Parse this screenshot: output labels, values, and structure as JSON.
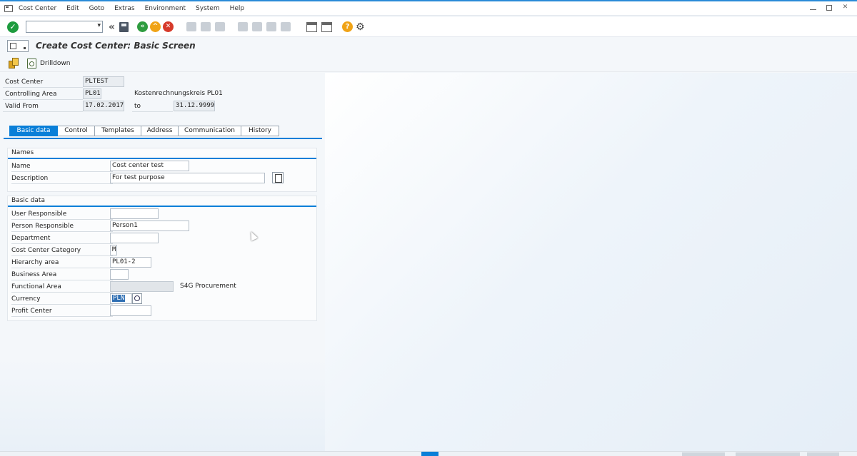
{
  "menubar": {
    "items": [
      "Cost Center",
      "Edit",
      "Goto",
      "Extras",
      "Environment",
      "System",
      "Help"
    ]
  },
  "toolbar": {
    "command_field_value": ""
  },
  "title": "Create Cost Center: Basic Screen",
  "app_toolbar": {
    "drilldown_label": "Drilldown"
  },
  "header_fields": {
    "cost_center_label": "Cost Center",
    "cost_center_value": "PLTEST",
    "controlling_area_label": "Controlling Area",
    "controlling_area_value": "PL01",
    "controlling_area_text": "Kostenrechnungskreis PL01",
    "valid_from_label": "Valid From",
    "valid_from_value": "17.02.2017",
    "to_label": "to",
    "valid_to_value": "31.12.9999"
  },
  "tabs": [
    "Basic data",
    "Control",
    "Templates",
    "Address",
    "Communication",
    "History"
  ],
  "names_group": {
    "title": "Names",
    "name_label": "Name",
    "name_value": "Cost center test",
    "description_label": "Description",
    "description_value": "For test purpose"
  },
  "basic_group": {
    "title": "Basic data",
    "user_responsible_label": "User Responsible",
    "user_responsible_value": "",
    "person_responsible_label": "Person Responsible",
    "person_responsible_value": "Person1",
    "department_label": "Department",
    "department_value": "",
    "category_label": "Cost Center Category",
    "category_value": "M",
    "hierarchy_label": "Hierarchy area",
    "hierarchy_value": "PL01-2",
    "business_area_label": "Business Area",
    "business_area_value": "",
    "functional_area_label": "Functional Area",
    "functional_area_value": "",
    "functional_area_text": "S4G Procurement",
    "currency_label": "Currency",
    "currency_value": "PLN",
    "profit_center_label": "Profit Center",
    "profit_center_value": ""
  },
  "colors": {
    "accent": "#0a7fd8",
    "ok_green": "#1d9b3e",
    "cancel_red": "#d63a2a",
    "exit_orange": "#f0a316"
  }
}
